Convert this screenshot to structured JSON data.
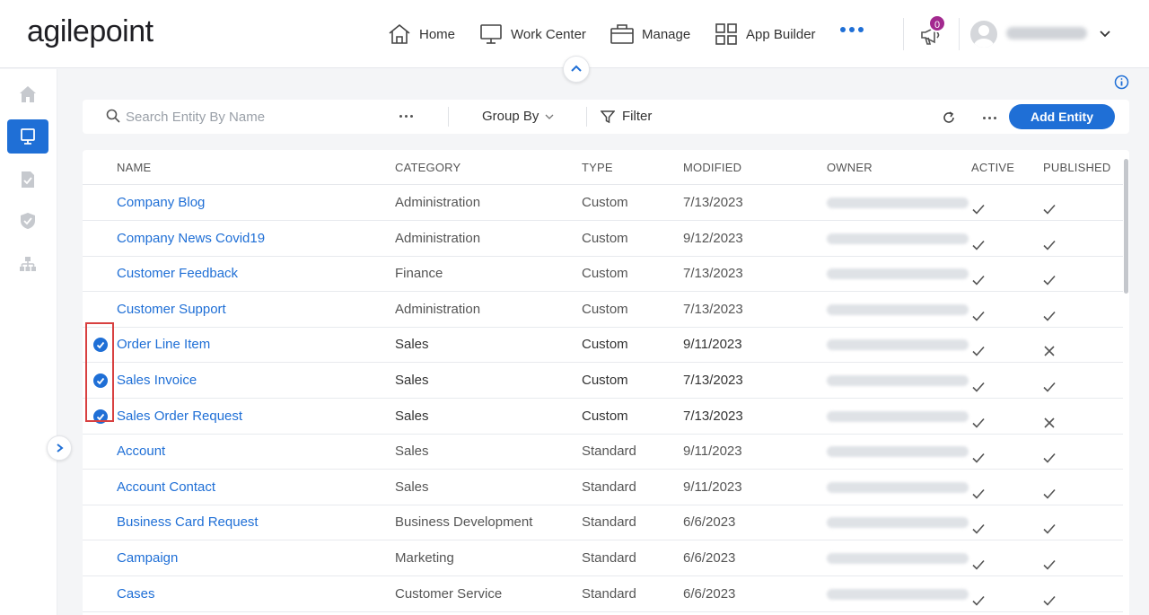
{
  "header": {
    "logo": "agilepoint",
    "nav": [
      {
        "label": "Home",
        "icon": "home-icon"
      },
      {
        "label": "Work Center",
        "icon": "monitor-icon"
      },
      {
        "label": "Manage",
        "icon": "briefcase-icon"
      },
      {
        "label": "App Builder",
        "icon": "grid-icon"
      }
    ],
    "notification_count": "0",
    "accent_color": "#1f6fd6",
    "badge_color": "#a3298f"
  },
  "toolbar": {
    "search_placeholder": "Search Entity By Name",
    "group_by_label": "Group By",
    "filter_label": "Filter",
    "add_entity_label": "Add Entity"
  },
  "table": {
    "columns": [
      "NAME",
      "CATEGORY",
      "TYPE",
      "MODIFIED",
      "OWNER",
      "ACTIVE",
      "PUBLISHED"
    ],
    "rows": [
      {
        "name": "Company Blog",
        "category": "Administration",
        "type": "Custom",
        "modified": "7/13/2023",
        "active": "check",
        "published": "check",
        "selected": false
      },
      {
        "name": "Company News Covid19",
        "category": "Administration",
        "type": "Custom",
        "modified": "9/12/2023",
        "active": "check",
        "published": "check",
        "selected": false
      },
      {
        "name": "Customer Feedback",
        "category": "Finance",
        "type": "Custom",
        "modified": "7/13/2023",
        "active": "check",
        "published": "check",
        "selected": false
      },
      {
        "name": "Customer Support",
        "category": "Administration",
        "type": "Custom",
        "modified": "7/13/2023",
        "active": "check",
        "published": "check",
        "selected": false
      },
      {
        "name": "Order Line Item",
        "category": "Sales",
        "type": "Custom",
        "modified": "9/11/2023",
        "active": "check",
        "published": "cross",
        "selected": true
      },
      {
        "name": "Sales Invoice",
        "category": "Sales",
        "type": "Custom",
        "modified": "7/13/2023",
        "active": "check",
        "published": "check",
        "selected": true
      },
      {
        "name": "Sales Order Request",
        "category": "Sales",
        "type": "Custom",
        "modified": "7/13/2023",
        "active": "check",
        "published": "cross",
        "selected": true
      },
      {
        "name": "Account",
        "category": "Sales",
        "type": "Standard",
        "modified": "9/11/2023",
        "active": "check",
        "published": "check",
        "selected": false
      },
      {
        "name": "Account Contact",
        "category": "Sales",
        "type": "Standard",
        "modified": "9/11/2023",
        "active": "check",
        "published": "check",
        "selected": false
      },
      {
        "name": "Business Card Request",
        "category": "Business Development",
        "type": "Standard",
        "modified": "6/6/2023",
        "active": "check",
        "published": "check",
        "selected": false
      },
      {
        "name": "Campaign",
        "category": "Marketing",
        "type": "Standard",
        "modified": "6/6/2023",
        "active": "check",
        "published": "check",
        "selected": false
      },
      {
        "name": "Cases",
        "category": "Customer Service",
        "type": "Standard",
        "modified": "6/6/2023",
        "active": "check",
        "published": "check",
        "selected": false
      }
    ]
  },
  "sidebar": {
    "items": [
      {
        "icon": "home-icon",
        "active": false
      },
      {
        "icon": "monitor-icon",
        "active": true
      },
      {
        "icon": "document-check-icon",
        "active": false
      },
      {
        "icon": "shield-icon",
        "active": false
      },
      {
        "icon": "org-chart-icon",
        "active": false
      }
    ]
  }
}
